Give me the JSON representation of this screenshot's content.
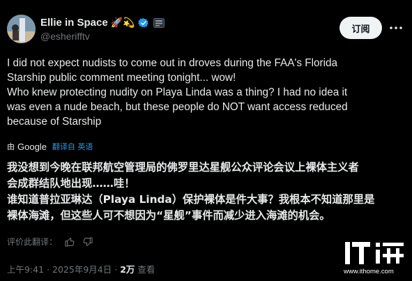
{
  "author": {
    "display_name": "Ellie in Space",
    "emojis": "🚀💫",
    "handle": "@esherifftv"
  },
  "header": {
    "subscribe_label": "订阅"
  },
  "tweet": {
    "lines": [
      "I did not expect nudists to come out in droves during the FAA's Florida",
      "Starship public comment meeting tonight... wow!",
      "Who knew protecting nudity on Playa Linda was a thing? I had no idea it",
      "was even a nude beach, but these people do NOT want access reduced",
      "because of Starship"
    ]
  },
  "translation": {
    "by_label": "由",
    "provider": "Google",
    "translated_from": "翻译自 英语",
    "lines": [
      "我没想到今晚在联邦航空管理局的佛罗里达星舰公众评论会议上裸体主义者",
      "会成群结队地出现……哇！",
      "谁知道普拉亚琳达（Playa Linda）保护裸体是件大事？我根本不知道那里是",
      "裸体海滩，但这些人可不想因为“星舰”事件而减少进入海滩的机会。"
    ],
    "rate_label": "评价此翻译："
  },
  "meta": {
    "time": "上午9:41",
    "date": "2025年9月4日",
    "separator": "·",
    "views_count": "2万",
    "views_label": "查看"
  },
  "watermark": {
    "url": "www.ithome.com"
  },
  "colors": {
    "background": "#000000",
    "text": "#e7e9ea",
    "secondary": "#71767b",
    "link": "#1d9bf0",
    "verified": "#1d9bf0"
  }
}
